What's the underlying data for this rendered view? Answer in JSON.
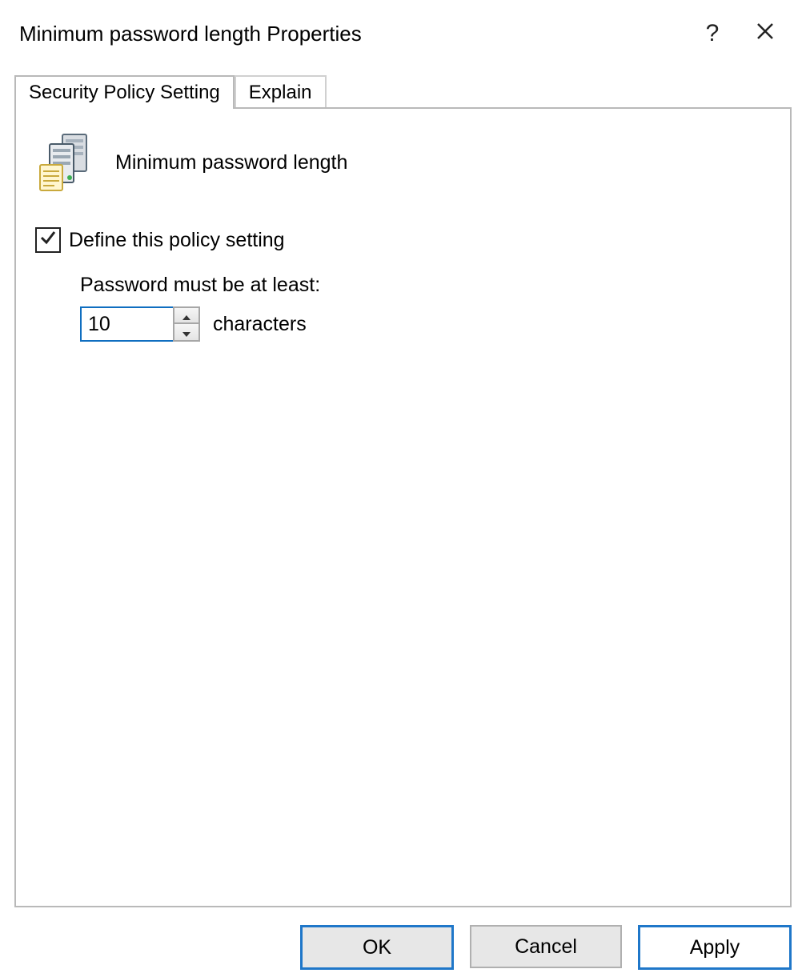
{
  "window": {
    "title": "Minimum password length Properties",
    "help_label": "?",
    "close_label": "Close"
  },
  "tabs": {
    "security": "Security Policy Setting",
    "explain": "Explain"
  },
  "policy": {
    "title": "Minimum password length",
    "define_label": "Define this policy setting",
    "define_checked": true,
    "field_label": "Password must be at least:",
    "value": "10",
    "suffix": "characters"
  },
  "buttons": {
    "ok": "OK",
    "cancel": "Cancel",
    "apply": "Apply"
  }
}
